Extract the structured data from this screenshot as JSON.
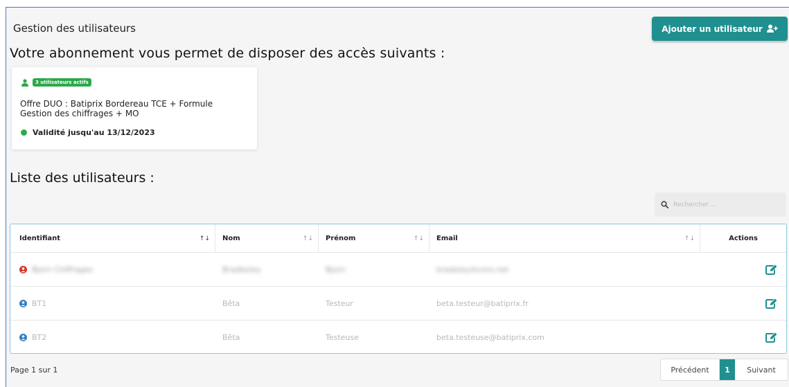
{
  "header": {
    "title": "Gestion des utilisateurs",
    "add_button_label": "Ajouter un utilisateur"
  },
  "subscription": {
    "heading": "Votre abonnement vous permet de disposer des accès suivants :",
    "active_users_badge": "3 utilisateurs actifs",
    "offer_line1": "Offre DUO : Batiprix Bordereau TCE + Formule",
    "offer_line2": "Gestion des chiffrages + MO",
    "validity": "Validité jusqu'au 13/12/2023"
  },
  "users_list": {
    "heading": "Liste des utilisateurs :",
    "search_placeholder": "Rechercher ...",
    "columns": [
      "Identifiant",
      "Nom",
      "Prénom",
      "Email",
      "Actions"
    ],
    "rows": [
      {
        "identifiant": "Bjorn Chiffrages",
        "nom": "Bradbeley",
        "prenom": "Bjorn",
        "email": "bradeley.bcons.net",
        "status_color": "#d9342b",
        "blurred": true
      },
      {
        "identifiant": "BT1",
        "nom": "Bêta",
        "prenom": "Testeur",
        "email": "beta.testeur@batiprix.fr",
        "status_color": "#2f7fc1",
        "blurred": false
      },
      {
        "identifiant": "BT2",
        "nom": "Bêta",
        "prenom": "Testeuse",
        "email": "beta.testeuse@batiprix.com",
        "status_color": "#2f7fc1",
        "blurred": false
      }
    ]
  },
  "pagination": {
    "page_info": "Page 1 sur 1",
    "previous": "Précédent",
    "current": "1",
    "next": "Suivant"
  },
  "colors": {
    "accent": "#1f8f8f",
    "active_green": "#2da84a",
    "edit_icon": "#1f8f8f"
  }
}
